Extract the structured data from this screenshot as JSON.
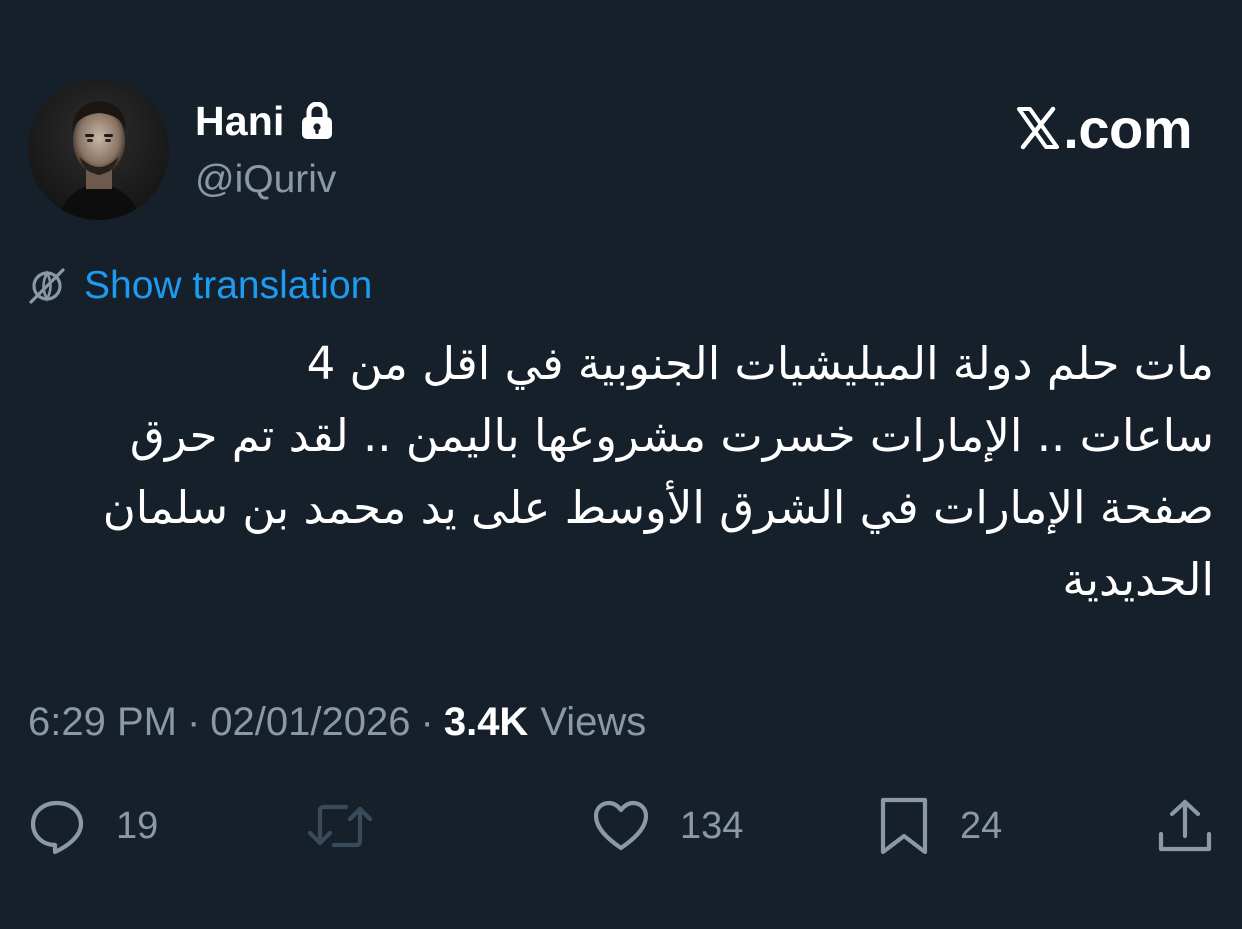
{
  "author": {
    "display_name": "Hani",
    "handle": "@iQuriv",
    "protected": true
  },
  "brand": {
    "text": ".com"
  },
  "translation": {
    "link_text": "Show translation"
  },
  "tweet": {
    "lines": [
      "مات حلم دولة الميليشيات الجنوبية في اقل من 4",
      "ساعات .. الإمارات خسرت مشروعها باليمن .. لقد تم حرق",
      "صفحة الإمارات في الشرق الأوسط على يد محمد بن سلمان",
      "الحديدية"
    ]
  },
  "meta": {
    "time": "6:29 PM",
    "separator": "·",
    "date": "02/01/2026",
    "views_count": "3.4K",
    "views_label": "Views"
  },
  "actions": {
    "replies": "19",
    "likes": "134",
    "bookmarks": "24"
  },
  "colors": {
    "background": "#15202b",
    "primary_text": "#ffffff",
    "secondary_text": "#8b98a5",
    "link": "#1d9bf0",
    "retweet_disabled": "#3a4a5a"
  },
  "icons": {
    "lock": "lock-icon",
    "brand": "x-logo-icon",
    "translate": "globe-slash-icon",
    "reply": "speech-bubble-icon",
    "retweet": "retweet-icon",
    "like": "heart-icon",
    "bookmark": "bookmark-icon",
    "share": "share-upload-icon"
  }
}
